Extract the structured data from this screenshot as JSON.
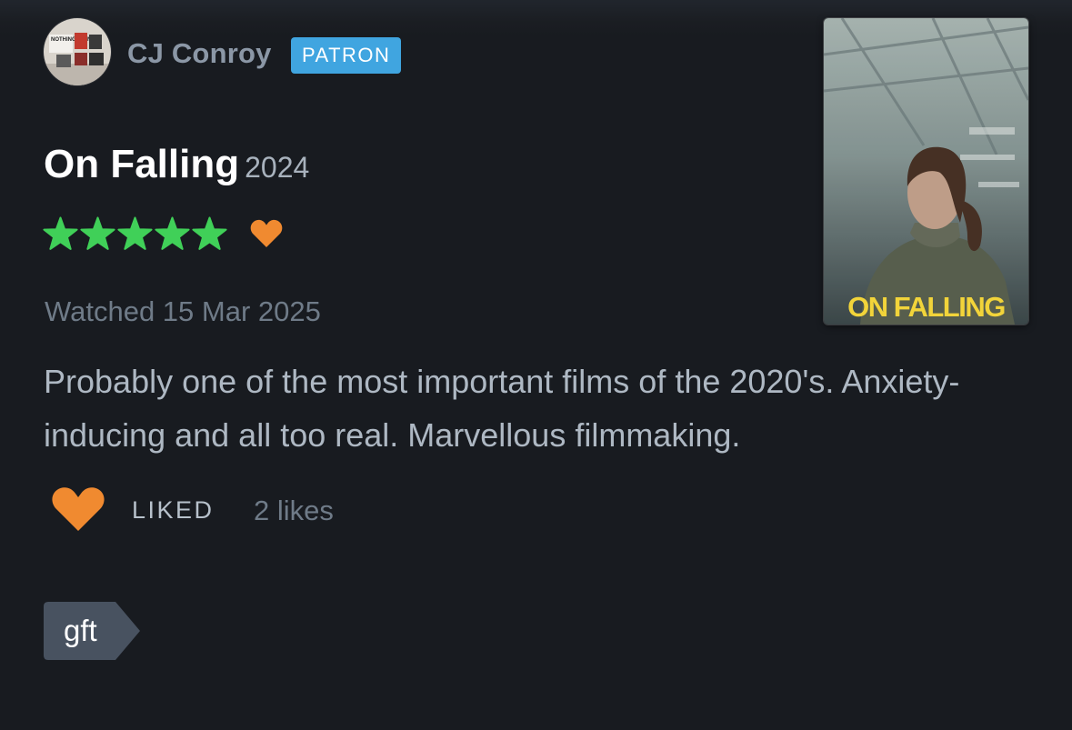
{
  "user": {
    "name": "CJ Conroy",
    "badge": "PATRON",
    "avatar_icon": "avatar-poster-collage",
    "avatar_text": "NOTHING DOING"
  },
  "film": {
    "title": "On Falling",
    "year": "2024",
    "rating_stars": 5,
    "rating_max": 5,
    "liked": true,
    "poster_title": "ON FALLING"
  },
  "watched": "Watched 15 Mar 2025",
  "review": "Probably one of the most important films of the 2020's. Anxiety-inducing and all too real. Marvellous filmmaking.",
  "actions": {
    "liked_label": "LIKED",
    "likes_count": "2 likes"
  },
  "tags": [
    "gft"
  ],
  "colors": {
    "background": "#181b20",
    "star_green": "#40d058",
    "heart_orange": "#f08a30",
    "badge_blue": "#40a5e0",
    "tag_bg": "#485260",
    "poster_title_yellow": "#f2d43a"
  }
}
